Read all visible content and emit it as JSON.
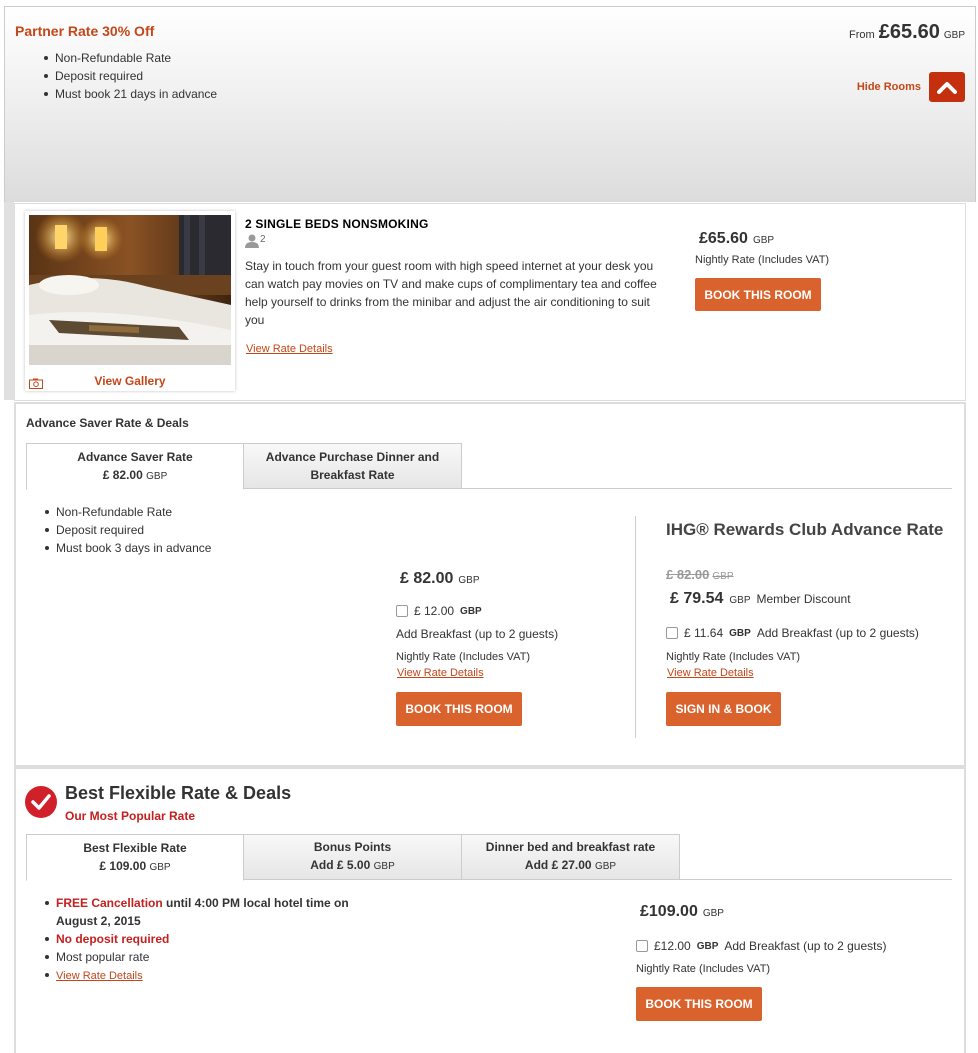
{
  "partner": {
    "title": "Partner Rate 30% Off",
    "bullets": [
      "Non-Refundable Rate",
      "Deposit required",
      "Must book 21 days in advance"
    ],
    "from_label": "From",
    "from_amount": "£65.60",
    "currency": "GBP",
    "hide_rooms_label": "Hide Rooms"
  },
  "room": {
    "title": "2 SINGLE BEDS NONSMOKING",
    "occupancy": "2",
    "description": "Stay in touch from your guest room with high speed internet at your desk you can watch pay movies on TV and make cups of complimentary tea and coffee help yourself to drinks from the minibar and adjust the air conditioning to suit you",
    "view_rate_details": "View Rate Details",
    "view_gallery": "View Gallery",
    "price": "£65.60",
    "currency": "GBP",
    "nightly": "Nightly Rate (Includes VAT)",
    "book_label": "BOOK THIS ROOM"
  },
  "advance": {
    "section_title": "Advance Saver Rate & Deals",
    "tabs": [
      {
        "label": "Advance Saver Rate",
        "sub": "£ 82.00",
        "ccy": "GBP"
      },
      {
        "label": "Advance Purchase Dinner and Breakfast Rate"
      }
    ],
    "bullets": [
      "Non-Refundable Rate",
      "Deposit required",
      "Must book 3 days in advance"
    ],
    "price": "£ 82.00",
    "currency": "GBP",
    "breakfast_price": "£ 12.00",
    "breakfast_label": "Add Breakfast (up to 2 guests)",
    "nightly": "Nightly Rate (Includes VAT)",
    "view_rate_details": "View Rate Details",
    "book_label": "BOOK THIS ROOM",
    "ihg": {
      "title": "IHG® Rewards Club Advance Rate",
      "old_price": "£ 82.00",
      "old_ccy": "GBP",
      "member_price": "£ 79.54",
      "member_ccy": "GBP",
      "member_label": "Member Discount",
      "breakfast_price": "£ 11.64",
      "breakfast_ccy": "GBP",
      "breakfast_label": "Add Breakfast (up to 2 guests)",
      "nightly": "Nightly Rate (Includes VAT)",
      "view_rate_details": "View Rate Details",
      "signin_label": "SIGN IN & BOOK"
    }
  },
  "flexible": {
    "title": "Best Flexible Rate & Deals",
    "subtitle": "Our Most Popular Rate",
    "tabs": [
      {
        "label": "Best Flexible Rate",
        "sub": "£ 109.00",
        "ccy": "GBP"
      },
      {
        "label": "Bonus Points",
        "sub": "Add  £ 5.00",
        "ccy": "GBP"
      },
      {
        "label": "Dinner bed and breakfast rate",
        "sub": "Add  £ 27.00",
        "ccy": "GBP"
      }
    ],
    "free_cancel_red": "FREE Cancellation",
    "free_cancel_rest": " until 4:00 PM local hotel time on August 2, 2015",
    "no_deposit": "No deposit required",
    "popular": "Most popular rate",
    "view_rate_details": "View Rate Details",
    "price": "£109.00",
    "currency": "GBP",
    "breakfast_price": "£12.00",
    "breakfast_ccy": "GBP",
    "breakfast_label": "Add Breakfast (up to 2 guests)",
    "nightly": "Nightly Rate (Includes VAT)",
    "book_label": "BOOK THIS ROOM"
  },
  "colors": {
    "accent": "#c4471a",
    "button": "#d9622d",
    "red": "#c4201f"
  }
}
